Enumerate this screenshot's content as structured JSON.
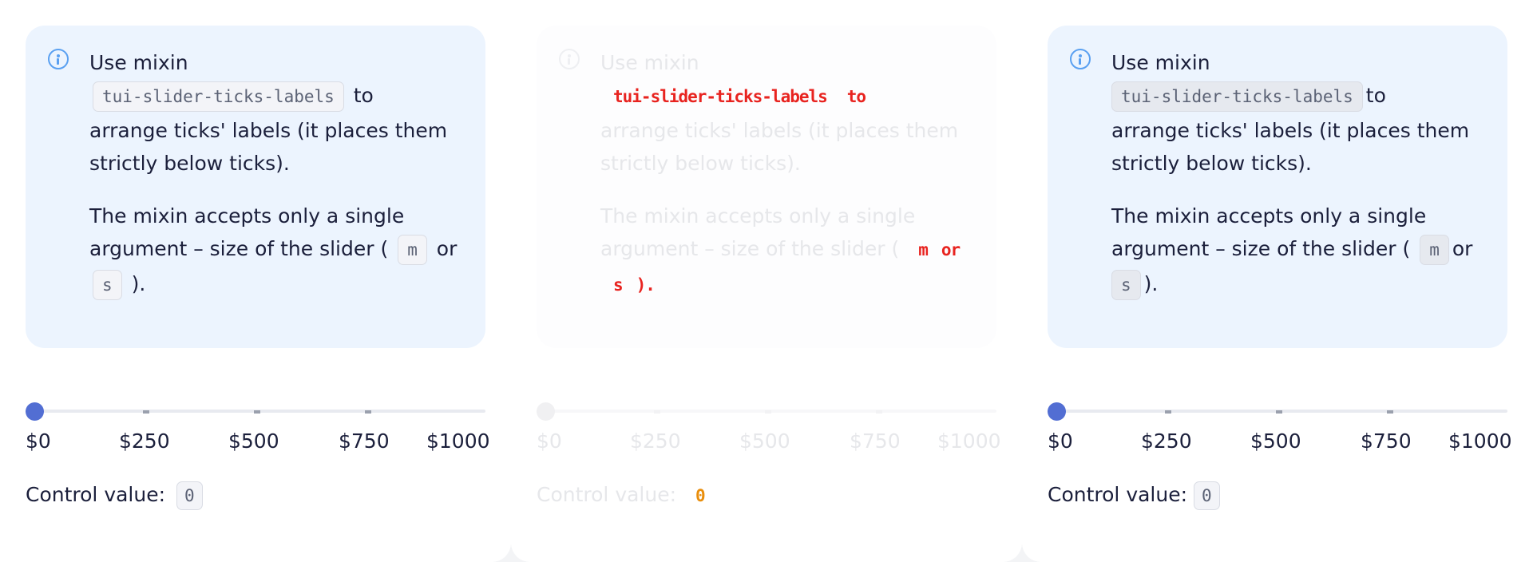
{
  "notification": {
    "line1": "Use mixin",
    "code_mixin": "tui-slider-ticks-labels",
    "word_to": "to",
    "line3": "arrange ticks' labels (it places them",
    "line4": "strictly below ticks).",
    "line5": "The mixin accepts only a single",
    "line6_prefix": "argument – size of the slider (",
    "code_m": "m",
    "word_or": "or",
    "code_s": "s",
    "line7_suffix": ")."
  },
  "slider": {
    "value": 0,
    "min": 0,
    "max": 1000,
    "tick_labels": [
      "$0",
      "$250",
      "$500",
      "$750",
      "$1000"
    ]
  },
  "control": {
    "label": "Control value:",
    "value": "0"
  },
  "colors": {
    "thumb": "#526ed3",
    "notification_bg": "#ecf4fe",
    "info_icon": "#5aa0f1"
  },
  "icons": [
    "info-icon"
  ]
}
